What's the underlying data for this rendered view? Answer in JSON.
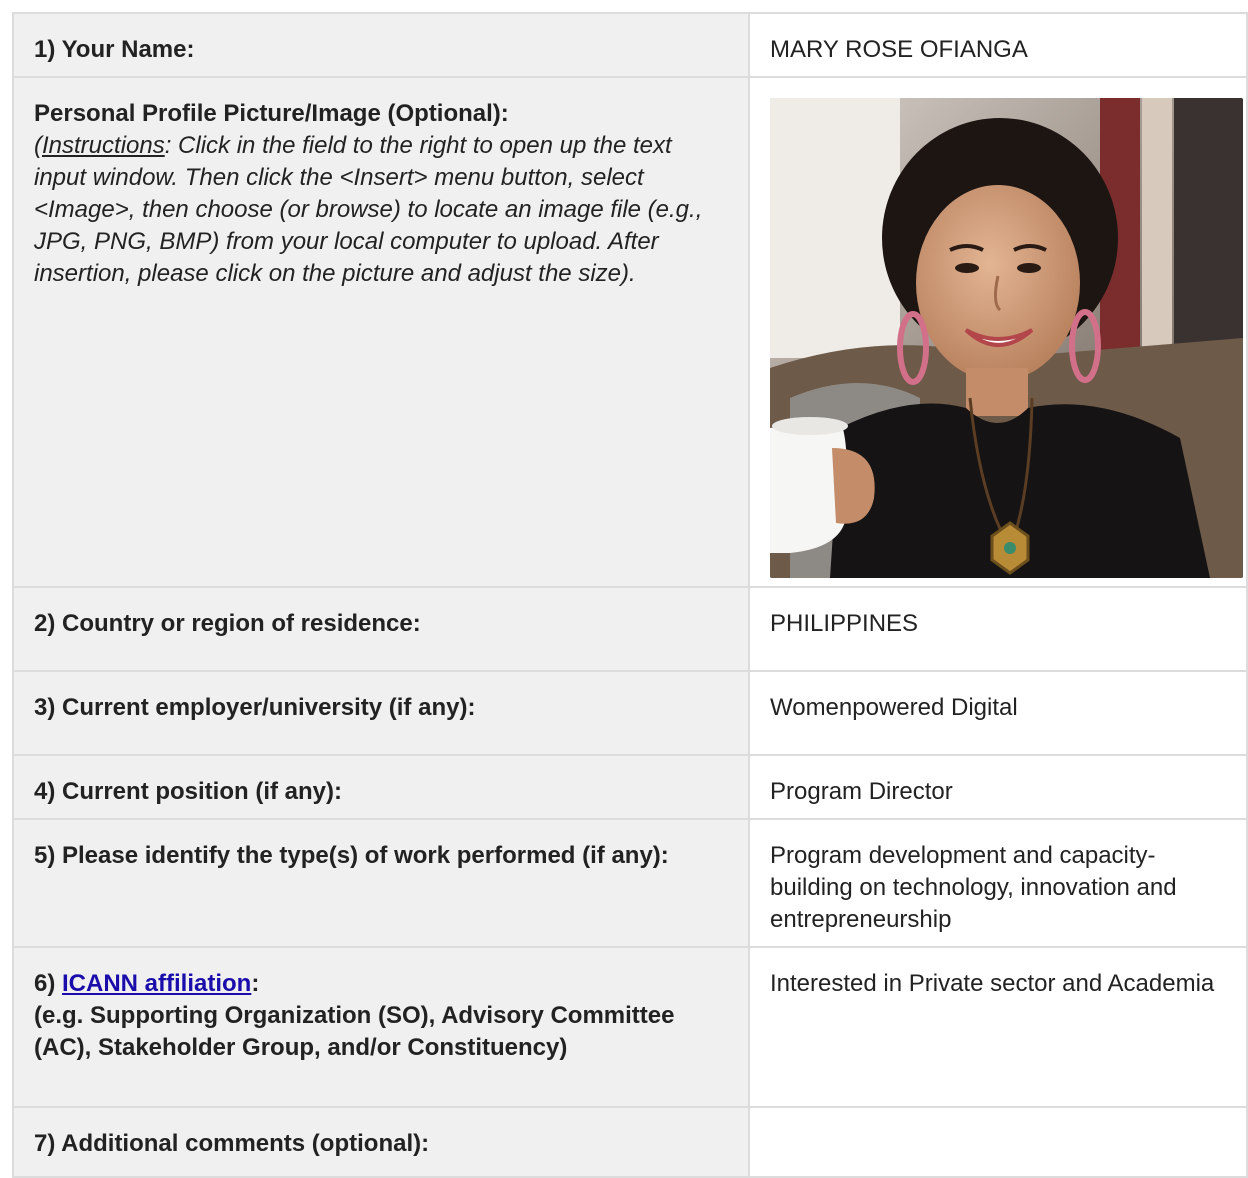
{
  "rows": {
    "name": {
      "label": "1) Your Name:",
      "value": "MARY ROSE OFIANGA"
    },
    "photo": {
      "label": "Personal Profile Picture/Image (Optional):",
      "instructions_open": "(",
      "instructions_word": "Instructions",
      "instructions_text": ": Click in the field to the right to open up the text input window. Then click the <Insert> menu button, select <Image>, then choose (or browse) to locate an image file (e.g., JPG, PNG, BMP) from your local computer to upload. After insertion, please click on the picture and adjust the size)."
    },
    "country": {
      "label": "2) Country or region of residence:",
      "value": "PHILIPPINES"
    },
    "employer": {
      "label": "3) Current employer/university (if any):",
      "value": "Womenpowered Digital"
    },
    "position": {
      "label": "4) Current position (if any):",
      "value": "Program Director"
    },
    "work": {
      "label": "5) Please identify the type(s) of work performed (if any):",
      "value": "Program development and capacity-building on technology, innovation and entrepreneurship"
    },
    "affiliation": {
      "prefix": "6) ",
      "link_text": "ICANN affiliation",
      "colon": ":",
      "detail": "(e.g. Supporting Organization (SO), Advisory Committee (AC), Stakeholder Group, and/or Constituency)",
      "value": "Interested in Private sector and Academia"
    },
    "comments": {
      "label": "7) Additional comments (optional):",
      "value": ""
    }
  },
  "colors": {
    "label_bg": "#f0f0f0",
    "border": "#dcdcdc",
    "link": "#1a0dab"
  }
}
